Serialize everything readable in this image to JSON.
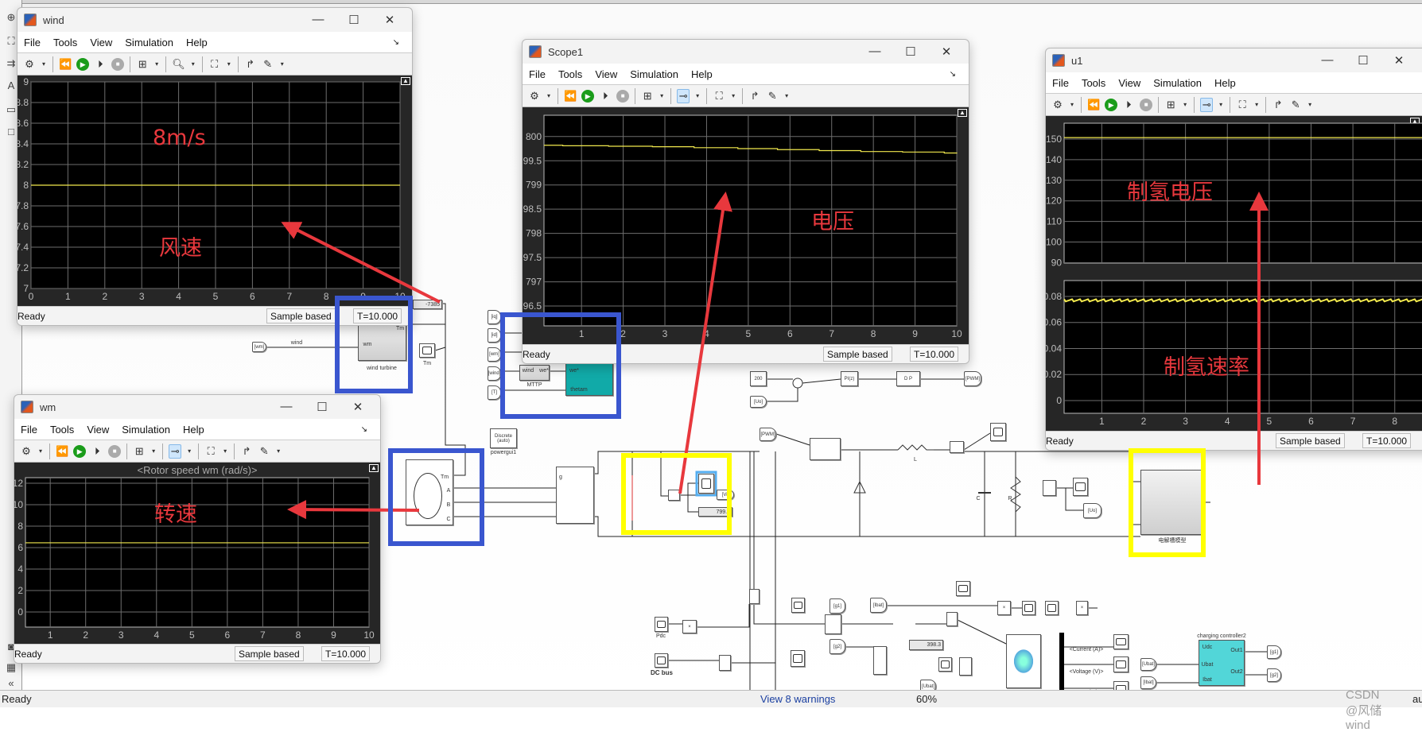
{
  "app": {
    "status": "Ready",
    "warnings": "View 8 warnings",
    "zoom": "60%",
    "watermark": "CSDN @风储wind",
    "right_clip": "au"
  },
  "scope_menu": [
    "File",
    "Tools",
    "View",
    "Simulation",
    "Help"
  ],
  "toolbar_icons": [
    "gear-icon",
    "step-back-icon",
    "run-icon",
    "step-forward-icon",
    "stop-icon",
    "signal-layout-icon",
    "zoom-icon",
    "trigger-icon",
    "fit-axes-icon",
    "highlight-block-icon",
    "measurement-icon"
  ],
  "windows": [
    {
      "title": "wind",
      "status": "Ready",
      "mode": "Sample based",
      "time": "T=10.000",
      "active_tool": "zoom"
    },
    {
      "title": "Scope1",
      "status": "Ready",
      "mode": "Sample based",
      "time": "T=10.000",
      "active_tool": "trigger"
    },
    {
      "title": "u1",
      "status": "Ready",
      "mode": "Sample based",
      "time": "T=10.000",
      "active_tool": "trigger"
    },
    {
      "title": "wm",
      "status": "Ready",
      "mode": "Sample based",
      "time": "T=10.000",
      "active_tool": "trigger"
    }
  ],
  "colors": {
    "trace": "#f2e94e",
    "plot_bg": "#000000",
    "frame_bg": "#262626",
    "grid": "#6e6e6e",
    "annotation_red": "#e8383d",
    "highlight_blue": "#3a56cf",
    "highlight_yellow": "#ffff00"
  },
  "chart_data": [
    {
      "type": "line",
      "window": "wind",
      "title": "",
      "xlim": [
        0,
        10
      ],
      "ylim": [
        7,
        9
      ],
      "xticks": [
        0,
        1,
        2,
        3,
        4,
        5,
        6,
        7,
        8,
        9,
        10
      ],
      "xticklabels": [
        "0",
        "1",
        "2",
        "3",
        "4",
        "5",
        "6",
        "7",
        "8",
        "9",
        "10"
      ],
      "yticks": [
        7,
        7.2,
        7.4,
        7.6,
        7.8,
        8,
        8.2,
        8.4,
        8.6,
        8.8,
        9
      ],
      "yticklabels": [
        "7",
        "7.2",
        "7.4",
        "7.6",
        "7.8",
        "8",
        "8.2",
        "8.4",
        "8.6",
        "8.8",
        "9"
      ],
      "grid": true,
      "series": [
        {
          "x": [
            0,
            10
          ],
          "y": [
            8,
            8
          ]
        }
      ]
    },
    {
      "type": "line",
      "window": "Scope1",
      "title": "",
      "xlim": [
        0.1,
        10
      ],
      "ylim": [
        796.09,
        800.44
      ],
      "xticks": [
        1,
        2,
        3,
        4,
        5,
        6,
        7,
        8,
        9,
        10
      ],
      "xticklabels": [
        "1",
        "2",
        "3",
        "4",
        "5",
        "6",
        "7",
        "8",
        "9",
        "10"
      ],
      "yticks": [
        796.5,
        797,
        797.5,
        798,
        798.5,
        799,
        799.5,
        800
      ],
      "yticklabels": [
        "796.5",
        "797",
        "797.5",
        "798",
        "798.5",
        "799",
        "799.5",
        "800"
      ],
      "grid": true,
      "step": true,
      "series": [
        {
          "x": [
            0.1,
            0.55,
            1.65,
            2.7,
            3.7,
            4.75,
            5.7,
            6.7,
            7.7,
            8.7,
            9.7,
            10
          ],
          "y": [
            799.82,
            799.81,
            799.8,
            799.79,
            799.77,
            799.75,
            799.73,
            799.71,
            799.69,
            799.68,
            799.66,
            799.65
          ]
        }
      ]
    },
    {
      "type": "line",
      "window": "u1",
      "title": "",
      "xlim": [
        0.1,
        10
      ],
      "ylim": [
        89.8,
        157.7
      ],
      "xticks": [
        1,
        2,
        3,
        4,
        5,
        6,
        7,
        8,
        9,
        10
      ],
      "xticklabels": [],
      "yticks": [
        90,
        100,
        110,
        120,
        130,
        140,
        150
      ],
      "yticklabels": [
        "90",
        "100",
        "110",
        "120",
        "130",
        "140",
        "150"
      ],
      "grid": true,
      "series": [
        {
          "x": [
            0.1,
            10
          ],
          "y": [
            150.7,
            150.7
          ]
        }
      ]
    },
    {
      "type": "line",
      "window": "u1",
      "title": "",
      "xlim": [
        0.1,
        10
      ],
      "ylim": [
        -0.0098,
        0.0922
      ],
      "xticks": [
        1,
        2,
        3,
        4,
        5,
        6,
        7,
        8,
        9,
        10
      ],
      "xticklabels": [
        "1",
        "2",
        "3",
        "4",
        "5",
        "6",
        "7",
        "8",
        "9",
        "10"
      ],
      "yticks": [
        0,
        0.02,
        0.04,
        0.06,
        0.08
      ],
      "yticklabels": [
        "0",
        "0.02",
        "0.04",
        "0.06",
        "0.08"
      ],
      "grid": true,
      "noisy": true,
      "series": [
        {
          "x": [
            0.1,
            10
          ],
          "y": [
            0.077,
            0.077
          ]
        }
      ]
    },
    {
      "type": "line",
      "window": "wm",
      "title": "<Rotor speed wm (rad/s)>",
      "xlim": [
        0.3,
        10
      ],
      "ylim": [
        -1.41,
        12.52
      ],
      "xticks": [
        1,
        2,
        3,
        4,
        5,
        6,
        7,
        8,
        9,
        10
      ],
      "xticklabels": [
        "1",
        "2",
        "3",
        "4",
        "5",
        "6",
        "7",
        "8",
        "9",
        "10"
      ],
      "yticks": [
        0,
        2,
        4,
        6,
        8,
        10,
        12
      ],
      "yticklabels": [
        "0",
        "2",
        "4",
        "6",
        "8",
        "10",
        "12"
      ],
      "grid": true,
      "series": [
        {
          "x": [
            0.3,
            10
          ],
          "y": [
            6.45,
            6.45
          ]
        }
      ]
    }
  ],
  "annotations": {
    "wind_value": "8m/s",
    "wind_label": "风速",
    "voltage_label": "电压",
    "h2_voltage_label": "制氢电压",
    "h2_rate_label": "制氢速率",
    "speed_label": "转速"
  },
  "blocks": {
    "display_torque": "-7385",
    "wind_turbine": "wind turbine",
    "wt_in": "wm",
    "wt_out": "Tm",
    "wind_tag_label": "wind",
    "wm_from": "[wm]",
    "tm_scope": "Tm",
    "tag_iq": "[iq]",
    "tag_id": "[id]",
    "tag_wm": "[wm]",
    "tag_wind": "[wind]",
    "tag_T": "[T]",
    "mttp": "MTTP",
    "mttp_in": "wind",
    "mttp_out": "we*",
    "ctrl_in1": "we*",
    "ctrl_in2": "thetam",
    "powergui": "Discrete (auto)",
    "powergui_label": "powergui1",
    "pmsg_tm": "Tm",
    "pmsg_a": "A",
    "pmsg_b": "B",
    "pmsg_c": "C",
    "rect_g": "g",
    "const_200": "200",
    "uo_from": "[Uo]",
    "pi": "PI(z)",
    "pwm_block": "D    P",
    "pwm_goto": "[PWM]",
    "pwm_from": "[PWM]",
    "inductor": "L",
    "cap": "C",
    "res": "R",
    "uo_goto": "[Uo]",
    "vi_goto": "[Vi]",
    "vdisplay": "799.6",
    "electrolyzer": "电解槽模型",
    "pdc": "Pdc",
    "dcbus": "DC bus",
    "g1_from": "[g1]",
    "g2_from": "[g2]",
    "ibat_from": "[Ibat]",
    "ubat_from": "[Ubat]",
    "batt_display": "398.3",
    "bus_current": "<Current (A)>",
    "bus_voltage": "<Voltage (V)>",
    "bus_soc": "<SOC (%)>",
    "ubat_in": "[Ubat]",
    "ibat_in": "[Ibat]",
    "charging": "charging controller2",
    "cc_udc": "Udc",
    "cc_ubat": "Ubat",
    "cc_ibat": "Ibat",
    "cc_out1": "Out1",
    "cc_out2": "Out2",
    "g1_goto": "[g1]",
    "g2_goto": "[g2]",
    "mult": "×"
  }
}
